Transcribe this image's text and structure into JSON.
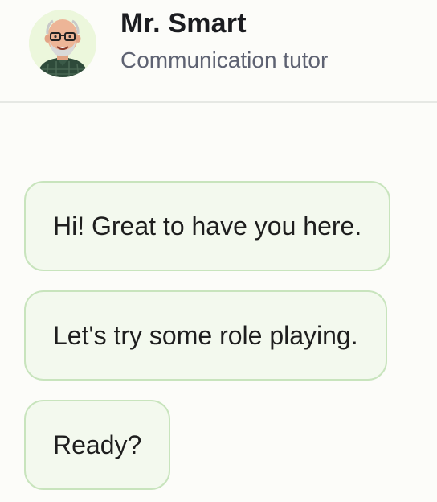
{
  "header": {
    "tutor_name": "Mr. Smart",
    "tutor_role": "Communication tutor",
    "avatar_icon": "tutor-avatar-icon"
  },
  "messages": [
    {
      "text": "Hi! Great to have you here."
    },
    {
      "text": "Let's try some role playing."
    },
    {
      "text": "Ready?"
    }
  ],
  "colors": {
    "background": "#fcfcf9",
    "bubble_fill": "#f3f9ee",
    "bubble_border": "#c8e4bd",
    "name_text": "#1b1c20",
    "role_text": "#5e6272",
    "divider": "#e6e8e4"
  }
}
